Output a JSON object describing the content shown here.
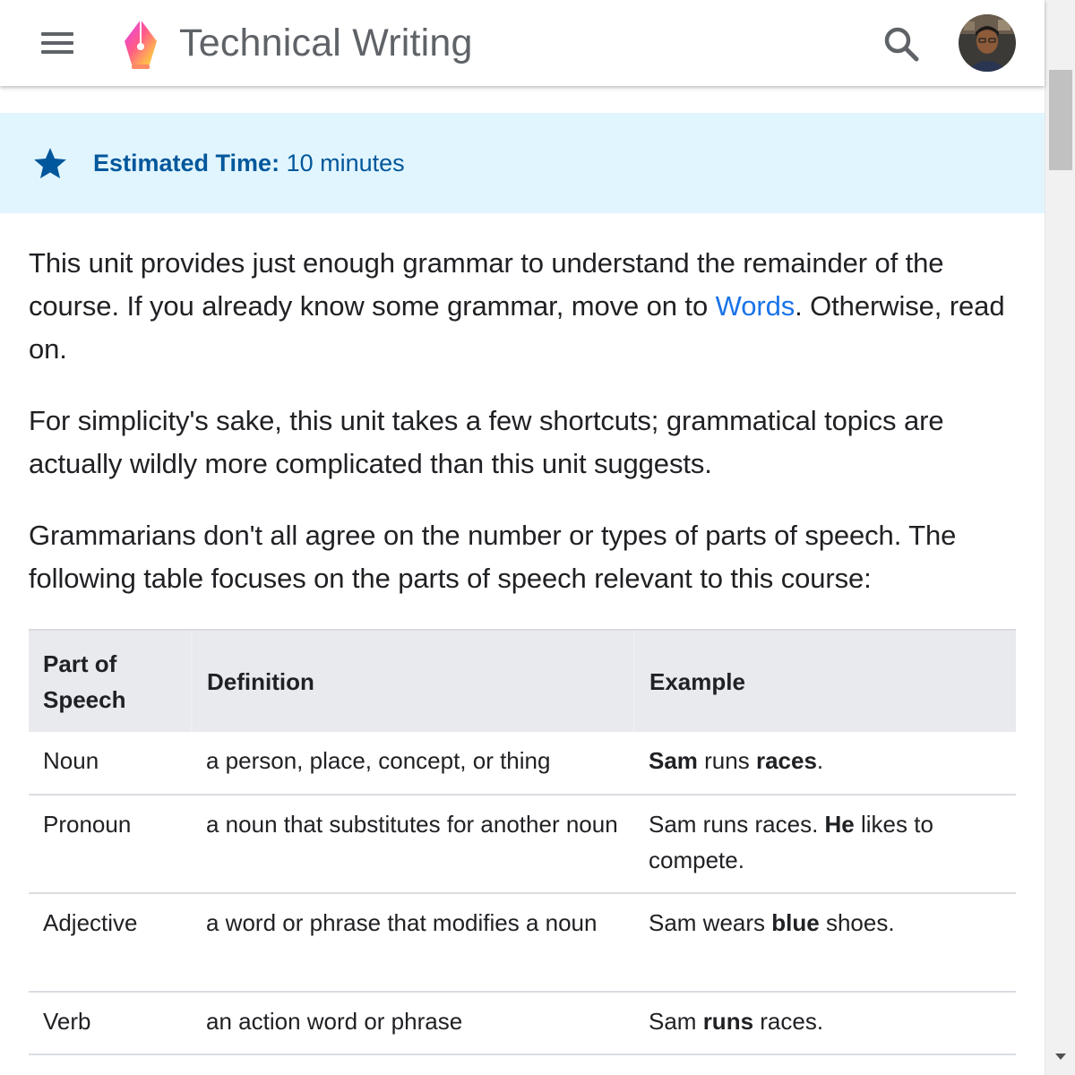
{
  "header": {
    "menu_icon": "hamburger-menu-icon",
    "logo_icon": "pen-nib-logo-icon",
    "title": "Technical Writing",
    "search_icon": "search-icon",
    "avatar_icon": "user-avatar"
  },
  "callout": {
    "icon": "star-icon",
    "label": "Estimated Time:",
    "value": " 10 minutes",
    "colors": {
      "background": "#e1f5fe",
      "text": "#01579b"
    }
  },
  "content": {
    "p1_before": "This unit provides just enough grammar to understand the remainder of the course. If you already know some grammar, move on to ",
    "p1_link": "Words",
    "p1_after": ". Otherwise, read on.",
    "p2": "For simplicity's sake, this unit takes a few shortcuts; grammatical topics are actually wildly more complicated than this unit suggests.",
    "p3": "Grammarians don't all agree on the number or types of parts of speech. The following table focuses on the parts of speech relevant to this course:"
  },
  "table": {
    "headers": [
      "Part of Speech",
      "Definition",
      "Example"
    ],
    "rows": [
      {
        "part": "Noun",
        "definition": "a person, place, concept, or thing",
        "example": [
          {
            "text": "Sam",
            "bold": true
          },
          {
            "text": " runs ",
            "bold": false
          },
          {
            "text": "races",
            "bold": true
          },
          {
            "text": ".",
            "bold": false
          }
        ]
      },
      {
        "part": "Pronoun",
        "definition": "a noun that substitutes for another noun",
        "example": [
          {
            "text": "Sam runs races. ",
            "bold": false
          },
          {
            "text": "He",
            "bold": true
          },
          {
            "text": " likes to compete.",
            "bold": false
          }
        ]
      },
      {
        "part": "Adjective",
        "definition": "a word or phrase that modifies a noun",
        "example": [
          {
            "text": "Sam wears ",
            "bold": false
          },
          {
            "text": "blue",
            "bold": true
          },
          {
            "text": " shoes.",
            "bold": false
          }
        ]
      },
      {
        "part": "Verb",
        "definition": "an action word or phrase",
        "example": [
          {
            "text": "Sam ",
            "bold": false
          },
          {
            "text": "runs",
            "bold": true
          },
          {
            "text": " races.",
            "bold": false
          }
        ]
      }
    ]
  },
  "colors": {
    "link": "#1a73e8",
    "header_title": "#5f6368",
    "table_header_bg": "#e8eaed"
  }
}
